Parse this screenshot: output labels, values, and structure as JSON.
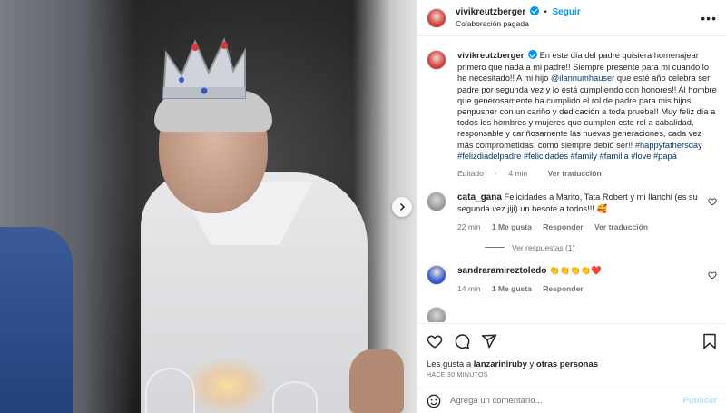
{
  "header": {
    "username": "vivikreutzberger",
    "separator": "•",
    "follow_label": "Seguir",
    "subline": "Colaboración pagada",
    "more_label": "•••"
  },
  "caption": {
    "username": "vivikreutzberger",
    "text_1": "En este día del padre quisiera homenajear primero que nada a mi padre!! Siempre presente para mi cuando lo he necesitado!! A mi hijo ",
    "mention": "@ilannumhauser",
    "text_2": " que esté año celebra ser padre por segunda vez y lo está cumpliendo con honores!! Al hombre que generosamente ha cumplido el rol de padre para mis hijos penpusher con un cariño y dedicación a toda prueba!! Muy feliz día a todos los hombres y mujeres que cumplen este rol a cabalidad, responsable y cariñosamente las nuevas generaciones, cada vez más comprometidas, como siempre debió ser!! ",
    "hashtags": "#happyfathersday #felizdiadelpadre #felicidades #family #familia #love #papá",
    "edited": "Editado",
    "dot": "·",
    "time": "4 min",
    "translate": "Ver traducción"
  },
  "comments": [
    {
      "username": "cata_gana",
      "text": "Felicidades a Marito, Tata Robert y mi Ilanchi (es su segunda vez jiji) un besote a todos!!! 🥰",
      "time": "22 min",
      "likes": "1 Me gusta",
      "reply": "Responder",
      "translate": "Ver traducción",
      "view_replies": "Ver respuestas (1)"
    },
    {
      "username": "sandraramireztoledo",
      "text": "👏👏👏👏❤️",
      "time": "14 min",
      "likes": "1 Me gusta",
      "reply": "Responder"
    }
  ],
  "likes_line": {
    "prefix": "Les gusta a ",
    "user": "lanzariniruby",
    "middle": " y ",
    "others": "otras personas"
  },
  "timestamp": "HACE 30 MINUTOS",
  "add_comment": {
    "placeholder": "Agrega un comentario...",
    "publish_label": "Publicar"
  },
  "icons": [
    "heart-icon",
    "comment-icon",
    "share-icon",
    "bookmark-icon",
    "emoji-icon",
    "chevron-right-icon",
    "verified-icon",
    "more-icon"
  ],
  "colors": {
    "accent": "#0095f6",
    "link": "#00376b",
    "muted": "#737373",
    "publish_disabled": "#b2dffc"
  }
}
